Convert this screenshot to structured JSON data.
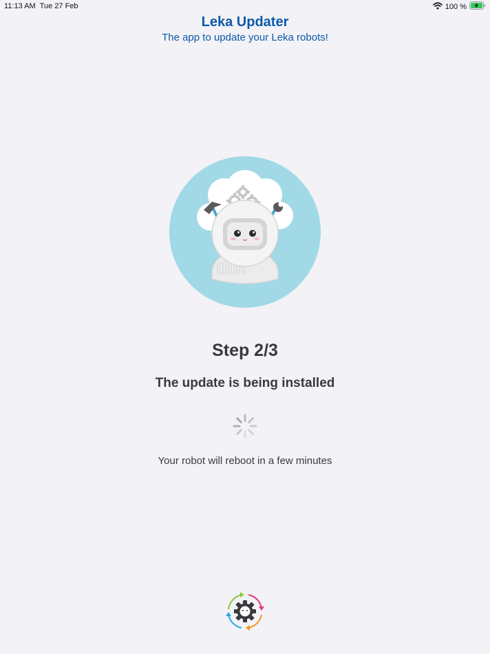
{
  "status_bar": {
    "time": "11:13 AM",
    "date": "Tue 27 Feb",
    "battery_percent": "100 %",
    "icons": [
      "wifi-icon",
      "battery-charging-icon"
    ]
  },
  "header": {
    "title": "Leka Updater",
    "subtitle": "The app to update your Leka robots!"
  },
  "main": {
    "step": "Step 2/3",
    "heading": "The update is being installed",
    "note": "Your robot will reboot in a few minutes"
  },
  "colors": {
    "accent": "#0d5aa7",
    "illustration_bg": "#a1d9e6",
    "text": "#3a3a3c",
    "background": "#f2f2f7"
  }
}
